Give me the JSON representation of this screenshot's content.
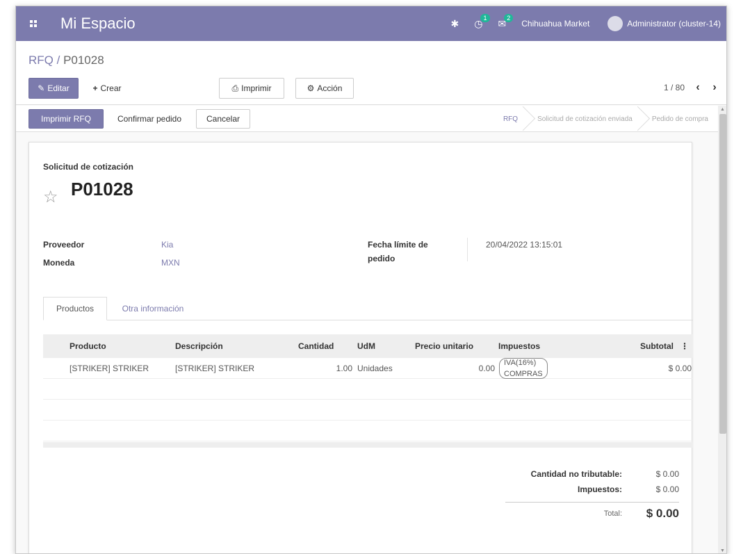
{
  "navbar": {
    "app_name": "Mi Espacio",
    "activity_count": "1",
    "message_count": "2",
    "company": "Chihuahua Market",
    "user": "Administrator (cluster-14)"
  },
  "breadcrumb": {
    "parent": "RFQ",
    "separator": " / ",
    "current": "P01028"
  },
  "toolbar": {
    "edit_label": "Editar",
    "create_label": "Crear",
    "print_label": "Imprimir",
    "action_label": "Acción",
    "pager": "1 / 80"
  },
  "statusbar": {
    "buttons": [
      "Imprimir RFQ",
      "Confirmar pedido",
      "Cancelar"
    ],
    "stages": [
      "RFQ",
      "Solicitud de cotización enviada",
      "Pedido de compra"
    ],
    "active_stage": "RFQ"
  },
  "form": {
    "doc_label": "Solicitud de cotización",
    "doc_name": "P01028",
    "fields": {
      "vendor_label": "Proveedor",
      "vendor_value": "Kia",
      "currency_label": "Moneda",
      "currency_value": "MXN",
      "deadline_label_1": "Fecha límite de",
      "deadline_label_2": "pedido",
      "deadline_value": "20/04/2022 13:15:01"
    },
    "tabs": [
      "Productos",
      "Otra información"
    ],
    "table": {
      "headers": [
        "Producto",
        "Descripción",
        "Cantidad",
        "UdM",
        "Precio unitario",
        "Impuestos",
        "Subtotal"
      ],
      "rows": [
        {
          "product": "[STRIKER] STRIKER",
          "description": "[STRIKER] STRIKER",
          "quantity": "1.00",
          "uom": "Unidades",
          "unit_price": "0.00",
          "taxes": "IVA(16%) COMPRAS",
          "subtotal": "$ 0.00"
        }
      ]
    },
    "totals": {
      "untaxed_label": "Cantidad no tributable:",
      "untaxed_value": "$ 0.00",
      "taxes_label": "Impuestos:",
      "taxes_value": "$ 0.00",
      "total_label": "Total:",
      "total_value": "$ 0.00"
    }
  },
  "colors": {
    "brand": "#7c7bad",
    "badge": "#21b799"
  }
}
